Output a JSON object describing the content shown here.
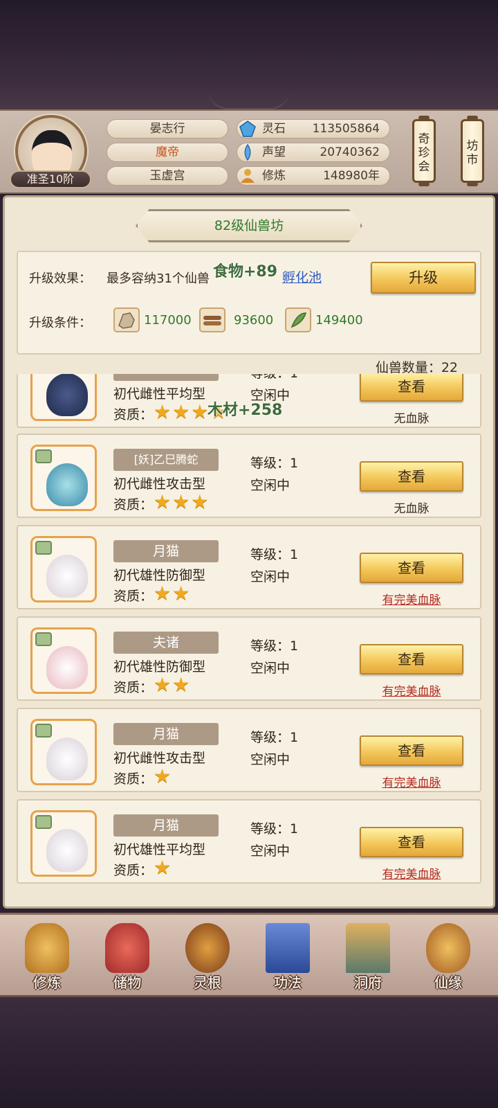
{
  "colors": {
    "accent_green": "#2e7a2a",
    "link_blue": "#2f5bc2",
    "perfect_red": "#b52a1f",
    "gold_btn": "#f3c75a"
  },
  "header": {
    "rank": "准圣10阶",
    "name": "晏志行",
    "title": "魔帝",
    "sect": "玉虚宫",
    "stats": [
      {
        "icon": "spirit-stone-icon",
        "label": "灵石",
        "value": "113505864"
      },
      {
        "icon": "reputation-icon",
        "label": "声望",
        "value": "20740362"
      },
      {
        "icon": "meditation-icon",
        "label": "修炼",
        "value": "148980年"
      }
    ],
    "side_buttons": [
      {
        "label": "奇珍会"
      },
      {
        "label": "坊市"
      }
    ]
  },
  "panel": {
    "title": "82级仙兽坊",
    "upgrade_effect_label": "升级效果：",
    "upgrade_effect_value": "最多容纳31个仙兽",
    "hatch_link": "孵化池",
    "upgrade_button": "升级",
    "upgrade_condition_label": "升级条件：",
    "resources": [
      {
        "icon": "ore-icon",
        "value": "117000"
      },
      {
        "icon": "wood-icon",
        "value": "93600"
      },
      {
        "icon": "herb-icon",
        "value": "149400"
      }
    ],
    "float_texts": [
      "食物+89",
      "木材+258"
    ],
    "count_label": "仙兽数量：22"
  },
  "pets": [
    {
      "name": "",
      "type": "初代雌性平均型",
      "quality_label": "资质：",
      "stars": 4,
      "level": "等级：1",
      "status": "空闲中",
      "view": "查看",
      "bloodline": "无血脉",
      "perfect": false
    },
    {
      "name": "[妖]乙巳腾蛇",
      "type": "初代雌性攻击型",
      "quality_label": "资质：",
      "stars": 3,
      "level": "等级：1",
      "status": "空闲中",
      "view": "查看",
      "bloodline": "无血脉",
      "perfect": false
    },
    {
      "name": "月猫",
      "type": "初代雄性防御型",
      "quality_label": "资质：",
      "stars": 2,
      "level": "等级：1",
      "status": "空闲中",
      "view": "查看",
      "bloodline": "有完美血脉",
      "perfect": true
    },
    {
      "name": "夫诸",
      "type": "初代雄性防御型",
      "quality_label": "资质：",
      "stars": 2,
      "level": "等级：1",
      "status": "空闲中",
      "view": "查看",
      "bloodline": "有完美血脉",
      "perfect": true
    },
    {
      "name": "月猫",
      "type": "初代雌性攻击型",
      "quality_label": "资质：",
      "stars": 1,
      "level": "等级：1",
      "status": "空闲中",
      "view": "查看",
      "bloodline": "有完美血脉",
      "perfect": true
    },
    {
      "name": "月猫",
      "type": "初代雄性平均型",
      "quality_label": "资质：",
      "stars": 1,
      "level": "等级：1",
      "status": "空闲中",
      "view": "查看",
      "bloodline": "有完美血脉",
      "perfect": true
    }
  ],
  "nav": [
    {
      "label": "修炼",
      "icon": "cultivate-icon"
    },
    {
      "label": "储物",
      "icon": "storage-bag-icon"
    },
    {
      "label": "灵根",
      "icon": "spirit-root-icon"
    },
    {
      "label": "功法",
      "icon": "technique-book-icon"
    },
    {
      "label": "洞府",
      "icon": "cave-mansion-icon"
    },
    {
      "label": "仙缘",
      "icon": "fate-gourd-icon"
    }
  ]
}
